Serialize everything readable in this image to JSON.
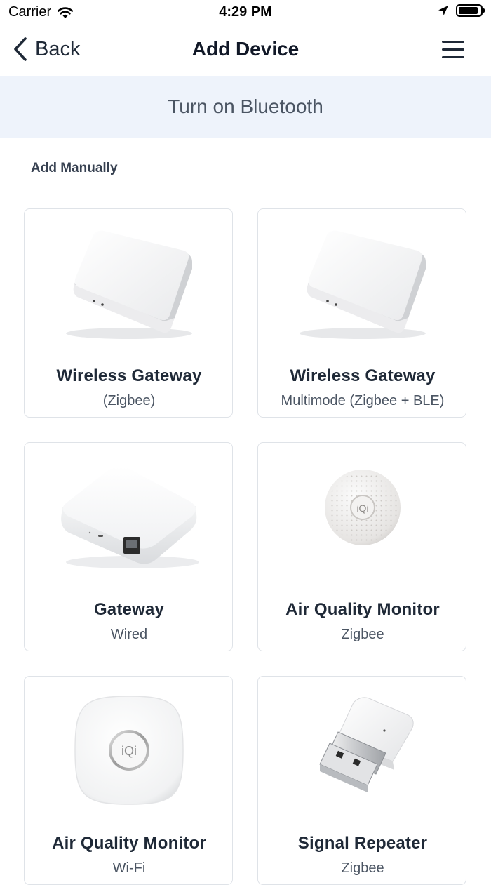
{
  "status_bar": {
    "carrier": "Carrier",
    "time": "4:29 PM",
    "battery_level": 0.9
  },
  "nav": {
    "back_label": "Back",
    "title": "Add Device"
  },
  "bluetooth_banner": {
    "label": "Turn on Bluetooth"
  },
  "section_label": "Add Manually",
  "devices": [
    {
      "name": "Wireless Gateway",
      "subtitle": "(Zigbee)",
      "icon": "hub-icon"
    },
    {
      "name": "Wireless Gateway",
      "subtitle": "Multimode (Zigbee + BLE)",
      "icon": "hub-icon"
    },
    {
      "name": "Gateway",
      "subtitle": "Wired",
      "icon": "wired-gateway-icon"
    },
    {
      "name": "Air Quality Monitor",
      "subtitle": "Zigbee",
      "icon": "air-monitor-round-icon",
      "logo": "iQi"
    },
    {
      "name": "Air Quality Monitor",
      "subtitle": "Wi-Fi",
      "icon": "air-monitor-square-icon",
      "logo": "iQi"
    },
    {
      "name": "Signal Repeater",
      "subtitle": "Zigbee",
      "icon": "usb-repeater-icon"
    }
  ],
  "colors": {
    "banner_bg": "#eef3fb",
    "card_border": "#dfe3e8",
    "text_primary": "#1f2937",
    "text_secondary": "#4b5563"
  }
}
